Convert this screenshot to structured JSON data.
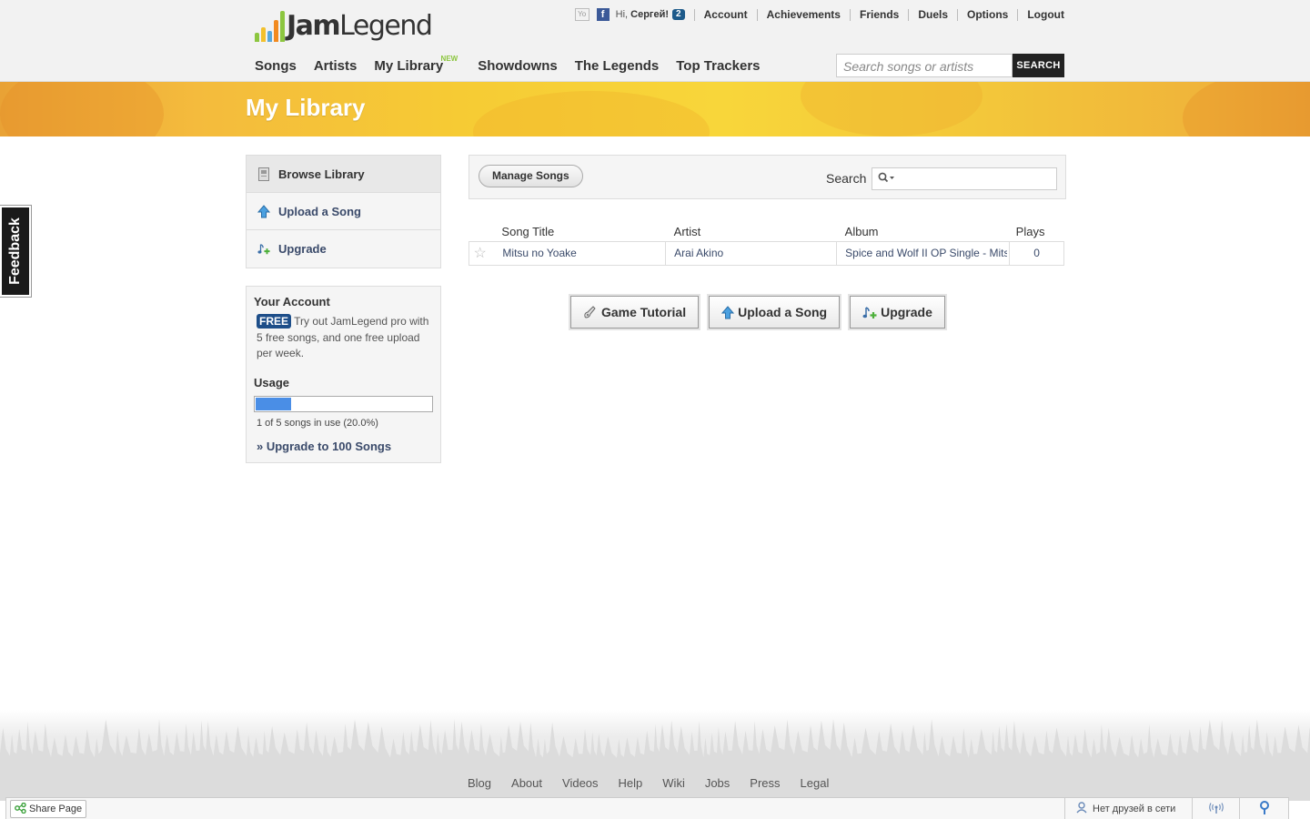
{
  "brand": {
    "name_a": "Jam",
    "name_b": "Legend",
    "bar_colors": [
      "#8cc63f",
      "#f2c12e",
      "#58a9dc",
      "#f28a1f",
      "#8cc63f"
    ]
  },
  "topnav": {
    "yo_label": "Yo",
    "fb_label": "f",
    "greeting_prefix": "Hi, ",
    "user_name": "Сергей!",
    "notification_count": "2",
    "links": [
      "Account",
      "Achievements",
      "Friends",
      "Duels",
      "Options",
      "Logout"
    ]
  },
  "mainnav": {
    "items": [
      "Songs",
      "Artists",
      "My Library",
      "Showdowns",
      "The Legends",
      "Top Trackers"
    ],
    "new_badge": "NEW"
  },
  "header_search": {
    "placeholder": "Search songs or artists",
    "button": "SEARCH"
  },
  "banner": {
    "title": "My Library"
  },
  "feedback": {
    "label": "Feedback"
  },
  "sidenav": {
    "items": [
      {
        "label": "Browse Library",
        "icon": "library-icon"
      },
      {
        "label": "Upload a Song",
        "icon": "upload-arrow-icon"
      },
      {
        "label": "Upgrade",
        "icon": "music-note-plus-icon"
      }
    ]
  },
  "account": {
    "title": "Your Account",
    "plan_badge": "FREE",
    "description": "Try out JamLegend pro with 5 free songs, and one free upload per week.",
    "usage_title": "Usage",
    "usage_fraction": 0.2,
    "usage_text": "1 of 5 songs in use (20.0%)",
    "upgrade_link": "» Upgrade to 100 Songs"
  },
  "toolbar": {
    "manage_label": "Manage Songs",
    "search_label": "Search",
    "search_value": ""
  },
  "table": {
    "headers": [
      "Song Title",
      "Artist",
      "Album",
      "Plays"
    ],
    "rows": [
      {
        "title": "Mitsu no Yoake",
        "artist": "Arai Akino",
        "album": "Spice and Wolf II OP Single - Mitsu no Yoake",
        "plays": "0"
      }
    ]
  },
  "actions": {
    "buttons": [
      {
        "label": "Game Tutorial",
        "icon": "guitar-icon"
      },
      {
        "label": "Upload a Song",
        "icon": "upload-arrow-icon"
      },
      {
        "label": "Upgrade",
        "icon": "music-note-plus-icon"
      }
    ]
  },
  "footer": {
    "links": [
      "Blog",
      "About",
      "Videos",
      "Help",
      "Wiki",
      "Jobs",
      "Press",
      "Legal"
    ]
  },
  "bottombar": {
    "share_label": "Share Page",
    "friends_status": "Нет друзей в сети"
  }
}
